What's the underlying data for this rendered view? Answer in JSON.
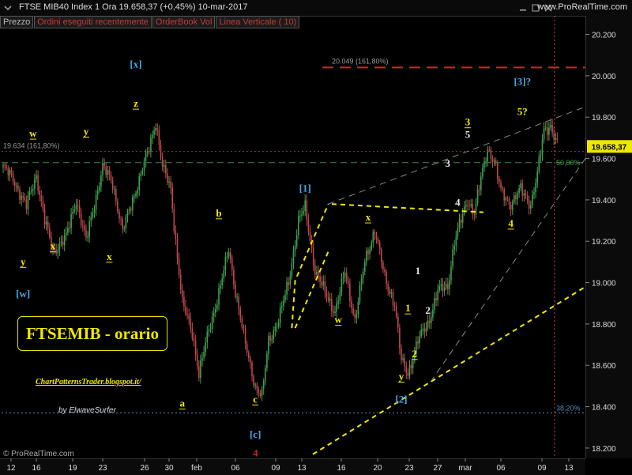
{
  "header": {
    "title": "FTSE MIB40 Index   1 Ora    19.658,37 (+0,45%)   10-mar-2017",
    "site": "www.ProRealTime.com"
  },
  "tabs": [
    "Prezzo",
    "Ordini eseguiti recentemente",
    "OrderBook Vol",
    "Linea Verticale ( 10)"
  ],
  "overlay": {
    "title_box": "FTSEMIB - orario",
    "blog": "ChartPatternsTrader.blogspot.it/",
    "byline": "by ElwaveSurfer",
    "copyright": "© ProRealTime.com"
  },
  "colors": {
    "up": "#3fa34d",
    "down": "#c0484f",
    "wave_yellow": "#f0e800",
    "wave_blue": "#4aa8e8",
    "resistance": "#e02020",
    "level_green": "#3a8a3a",
    "current_price_bg": "#f0e800"
  },
  "chart_data": {
    "type": "candlestick",
    "xlabel": "",
    "ylabel": "",
    "ylim": [
      18150,
      20290
    ],
    "yticks": [
      18200,
      18400,
      18600,
      18800,
      19000,
      19200,
      19400,
      19600,
      19800,
      20000,
      20200
    ],
    "ytick_labels": [
      "18.200",
      "18.400",
      "18.600",
      "18.800",
      "19.000",
      "19.200",
      "19.400",
      "19.600",
      "19.800",
      "20.000",
      "20.200"
    ],
    "xtick_labels": [
      "12",
      "16",
      "19",
      "23",
      "26",
      "30",
      "feb",
      "06",
      "09",
      "13",
      "16",
      "20",
      "23",
      "27",
      "mar",
      "06",
      "09",
      "13"
    ],
    "current_price": {
      "value": 19658.37,
      "label": "19.658,37"
    },
    "price_anchors": [
      {
        "i": 0,
        "v": 19560
      },
      {
        "i": 6,
        "v": 19500
      },
      {
        "i": 14,
        "v": 19370
      },
      {
        "i": 20,
        "v": 19520
      },
      {
        "i": 25,
        "v": 19300
      },
      {
        "i": 30,
        "v": 19150
      },
      {
        "i": 38,
        "v": 19220
      },
      {
        "i": 44,
        "v": 19400
      },
      {
        "i": 50,
        "v": 19200
      },
      {
        "i": 60,
        "v": 19560
      },
      {
        "i": 66,
        "v": 19480
      },
      {
        "i": 72,
        "v": 19250
      },
      {
        "i": 80,
        "v": 19450
      },
      {
        "i": 88,
        "v": 19650
      },
      {
        "i": 92,
        "v": 19780
      },
      {
        "i": 96,
        "v": 19560
      },
      {
        "i": 101,
        "v": 19450
      },
      {
        "i": 104,
        "v": 19200
      },
      {
        "i": 108,
        "v": 18900
      },
      {
        "i": 114,
        "v": 18760
      },
      {
        "i": 118,
        "v": 18560
      },
      {
        "i": 124,
        "v": 18770
      },
      {
        "i": 130,
        "v": 18950
      },
      {
        "i": 136,
        "v": 19160
      },
      {
        "i": 140,
        "v": 18960
      },
      {
        "i": 146,
        "v": 18700
      },
      {
        "i": 152,
        "v": 18500
      },
      {
        "i": 156,
        "v": 18450
      },
      {
        "i": 160,
        "v": 18720
      },
      {
        "i": 166,
        "v": 18820
      },
      {
        "i": 172,
        "v": 19000
      },
      {
        "i": 178,
        "v": 19300
      },
      {
        "i": 182,
        "v": 19360
      },
      {
        "i": 188,
        "v": 19060
      },
      {
        "i": 194,
        "v": 18950
      },
      {
        "i": 200,
        "v": 18860
      },
      {
        "i": 206,
        "v": 19050
      },
      {
        "i": 212,
        "v": 18820
      },
      {
        "i": 218,
        "v": 19100
      },
      {
        "i": 224,
        "v": 19260
      },
      {
        "i": 230,
        "v": 19020
      },
      {
        "i": 236,
        "v": 18900
      },
      {
        "i": 240,
        "v": 18620
      },
      {
        "i": 244,
        "v": 18560
      },
      {
        "i": 250,
        "v": 18720
      },
      {
        "i": 256,
        "v": 18800
      },
      {
        "i": 262,
        "v": 18960
      },
      {
        "i": 268,
        "v": 18980
      },
      {
        "i": 272,
        "v": 19200
      },
      {
        "i": 276,
        "v": 19300
      },
      {
        "i": 280,
        "v": 19400
      },
      {
        "i": 284,
        "v": 19340
      },
      {
        "i": 288,
        "v": 19500
      },
      {
        "i": 292,
        "v": 19650
      },
      {
        "i": 296,
        "v": 19590
      },
      {
        "i": 300,
        "v": 19440
      },
      {
        "i": 306,
        "v": 19380
      },
      {
        "i": 312,
        "v": 19450
      },
      {
        "i": 318,
        "v": 19380
      },
      {
        "i": 322,
        "v": 19520
      },
      {
        "i": 326,
        "v": 19740
      },
      {
        "i": 330,
        "v": 19760
      },
      {
        "i": 334,
        "v": 19658
      }
    ],
    "levels": [
      {
        "name": "161.80% resistance",
        "value": 20040,
        "label": "20.049 (161,80%)",
        "color": "#e02020"
      },
      {
        "name": "50% level",
        "value": 19580,
        "label": "50,00%",
        "color": "#3a8a3a"
      },
      {
        "name": "161.80% level",
        "value": 19634,
        "label": "19.634 (161,80%)",
        "color": "#8a3a3a"
      },
      {
        "name": "38.20% level",
        "value": 18370,
        "label": "38,20%",
        "color": "#5a8ab8"
      }
    ],
    "wave_labels": [
      {
        "text": "[x]",
        "date_i": 80,
        "value": 20040,
        "color": "blue"
      },
      {
        "text": "z",
        "date_i": 80,
        "value": 19850,
        "color": "yellow"
      },
      {
        "text": "w",
        "date_i": 18,
        "value": 19705,
        "color": "yellow"
      },
      {
        "text": "y",
        "date_i": 50,
        "value": 19715,
        "color": "yellow"
      },
      {
        "text": "y",
        "date_i": 12,
        "value": 19085,
        "color": "yellow"
      },
      {
        "text": "[w]",
        "date_i": 12,
        "value": 18930,
        "color": "blue"
      },
      {
        "text": "x",
        "date_i": 30,
        "value": 19160,
        "color": "yellow"
      },
      {
        "text": "x",
        "date_i": 64,
        "value": 19110,
        "color": "yellow"
      },
      {
        "text": "b",
        "date_i": 130,
        "value": 19320,
        "color": "yellow"
      },
      {
        "text": "a",
        "date_i": 108,
        "value": 18400,
        "color": "yellow"
      },
      {
        "text": "c",
        "date_i": 152,
        "value": 18420,
        "color": "yellow"
      },
      {
        "text": "[c]",
        "date_i": 152,
        "value": 18250,
        "color": "blue"
      },
      {
        "text": "4",
        "date_i": 152,
        "value": 18160,
        "color": "red"
      },
      {
        "text": "[1]",
        "date_i": 182,
        "value": 19440,
        "color": "blue"
      },
      {
        "text": "x",
        "date_i": 220,
        "value": 19300,
        "color": "yellow"
      },
      {
        "text": "w",
        "date_i": 202,
        "value": 18805,
        "color": "yellow"
      },
      {
        "text": "1",
        "date_i": 244,
        "value": 18860,
        "color": "yellow"
      },
      {
        "text": "2",
        "date_i": 248,
        "value": 18640,
        "color": "yellow"
      },
      {
        "text": "y",
        "date_i": 240,
        "value": 18530,
        "color": "yellow"
      },
      {
        "text": "[2]",
        "date_i": 240,
        "value": 18420,
        "color": "blue"
      },
      {
        "text": "1",
        "date_i": 250,
        "value": 19040,
        "color": "white"
      },
      {
        "text": "2",
        "date_i": 256,
        "value": 18850,
        "color": "white"
      },
      {
        "text": "3",
        "date_i": 268,
        "value": 19560,
        "color": "white"
      },
      {
        "text": "4",
        "date_i": 274,
        "value": 19370,
        "color": "white"
      },
      {
        "text": "3",
        "date_i": 280,
        "value": 19760,
        "color": "yellow"
      },
      {
        "text": "5",
        "date_i": 280,
        "value": 19700,
        "color": "white"
      },
      {
        "text": "4",
        "date_i": 306,
        "value": 19270,
        "color": "yellow"
      },
      {
        "text": "5?",
        "date_i": 313,
        "value": 19810,
        "color": "yellow"
      },
      {
        "text": "[3]?",
        "date_i": 313,
        "value": 19955,
        "color": "blue"
      }
    ]
  }
}
